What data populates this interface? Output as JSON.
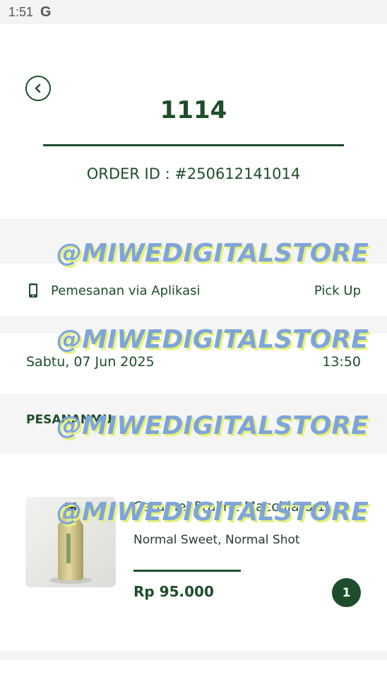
{
  "status_bar": {
    "time": "1:51",
    "google_glyph": "G"
  },
  "header": {
    "queue_number": "1114",
    "order_id": "ORDER ID : #250612141014"
  },
  "order_info": {
    "mode_icon": "phone-icon",
    "mode_label": "Pemesanan via Aplikasi",
    "mode_value": "Pick Up",
    "date": "Sabtu, 07 Jun 2025",
    "time": "13:50"
  },
  "section": {
    "title": "PESANANMU"
  },
  "items": [
    {
      "name": "Caramel Praline Macchiato 1L",
      "options": "Normal Sweet, Normal Shot",
      "price": "Rp 95.000",
      "quantity": "1"
    }
  ],
  "watermark": "@MIWEDIGITALSTORE",
  "colors": {
    "primary": "#1e4d2b",
    "band": "#f5f5f5",
    "watermark": "#7fa5d8",
    "watermark_shadow": "#e6f27a"
  }
}
